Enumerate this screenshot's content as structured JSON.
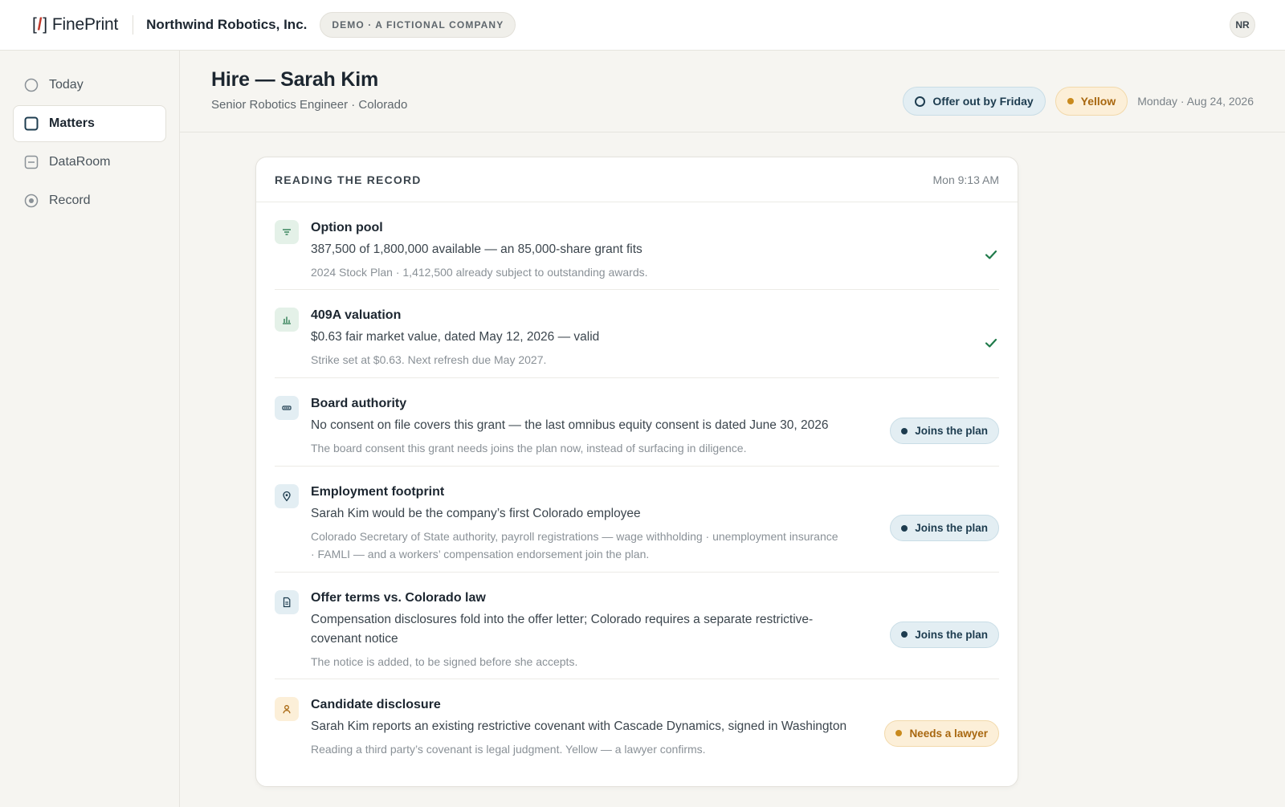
{
  "topbar": {
    "logo_bracket_open": "[",
    "logo_slash": "/",
    "logo_bracket_close": "]",
    "logo_name": "FinePrint",
    "company": "Northwind Robotics, Inc.",
    "demo_badge": "DEMO · A FICTIONAL COMPANY",
    "avatar_initials": "NR"
  },
  "sidebar": {
    "items": [
      {
        "label": "Today",
        "icon": "circle-icon",
        "active": false
      },
      {
        "label": "Matters",
        "icon": "square-icon",
        "active": true
      },
      {
        "label": "DataRoom",
        "icon": "drawer-icon",
        "active": false
      },
      {
        "label": "Record",
        "icon": "radio-dot-icon",
        "active": false
      }
    ]
  },
  "header": {
    "title": "Hire — Sarah Kim",
    "subtitle": "Senior Robotics Engineer · Colorado",
    "deadline_pill": "Offer out by Friday",
    "status_pill": "Yellow",
    "date": "Monday · Aug 24, 2026"
  },
  "card": {
    "title": "READING THE RECORD",
    "time": "Mon 9:13 AM",
    "rows": [
      {
        "title": "Option pool",
        "main": "387,500 of 1,800,000 available — an 85,000-share grant fits",
        "note": "2024 Stock Plan · 1,412,500 already subject to outstanding awards.",
        "icon": "filter-lines-icon",
        "status": "check"
      },
      {
        "title": "409A valuation",
        "main": "$0.63 fair market value, dated May 12, 2026 — valid",
        "note": "Strike set at $0.63. Next refresh due May 2027.",
        "icon": "bar-chart-icon",
        "status": "check"
      },
      {
        "title": "Board authority",
        "main": "No consent on file covers this grant — the last omnibus equity consent is dated June 30, 2026",
        "note": "The board consent this grant needs joins the plan now, instead of surfacing in diligence.",
        "icon": "board-seats-icon",
        "status": "Joins the plan"
      },
      {
        "title": "Employment footprint",
        "main": "Sarah Kim would be the company’s first Colorado employee",
        "note": "Colorado Secretary of State authority, payroll registrations — wage withholding · unemployment insurance · FAMLI — and a workers’ compensation endorsement join the plan.",
        "icon": "map-pin-icon",
        "status": "Joins the plan"
      },
      {
        "title": "Offer terms vs. Colorado law",
        "main": "Compensation disclosures fold into the offer letter; Colorado requires a separate restrictive-covenant notice",
        "note": "The notice is added, to be signed before she accepts.",
        "icon": "document-icon",
        "status": "Joins the plan"
      },
      {
        "title": "Candidate disclosure",
        "main": "Sarah Kim reports an existing restrictive covenant with Cascade Dynamics, signed in Washington",
        "note": "Reading a third party’s covenant is legal judgment. Yellow — a lawyer confirms.",
        "icon": "person-icon",
        "status": "Needs a lawyer"
      }
    ]
  },
  "colors": {
    "accent_blue": "#1d3c4f",
    "pill_blue_bg": "#e3eef3",
    "amber": "#a8670f",
    "amber_bg": "#fcefd8",
    "check_green": "#1f7a4a",
    "logo_slash": "#c0392b"
  }
}
